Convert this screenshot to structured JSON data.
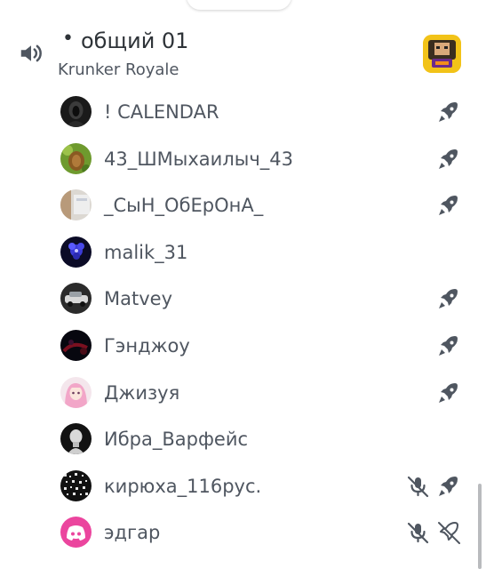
{
  "channel": {
    "name": "общий 01",
    "bullet": "•",
    "activity": "Krunker Royale",
    "speaker_icon": "speaker-icon",
    "activity_icon": "krunker-game-icon"
  },
  "members": [
    {
      "name": "! CALENDAR",
      "avatar_icon": "dark-hooded-figure-avatar",
      "icons": [
        "rocket-icon"
      ]
    },
    {
      "name": "43_ШМыхаилыч_43",
      "avatar_icon": "pinecone-avatar",
      "icons": [
        "rocket-icon"
      ]
    },
    {
      "name": "_СыН_ОбЕрОнА_",
      "avatar_icon": "pale-photo-avatar",
      "icons": [
        "rocket-icon"
      ]
    },
    {
      "name": "malik_31",
      "avatar_icon": "blue-flower-avatar",
      "icons": []
    },
    {
      "name": "Matvey",
      "avatar_icon": "car-avatar",
      "icons": [
        "rocket-icon"
      ]
    },
    {
      "name": "Гэнджоу",
      "avatar_icon": "dark-red-avatar",
      "icons": [
        "rocket-icon"
      ]
    },
    {
      "name": "Джизуя",
      "avatar_icon": "anime-girl-avatar",
      "icons": [
        "rocket-icon"
      ]
    },
    {
      "name": "Ибра_Варфейс",
      "avatar_icon": "statue-bust-avatar",
      "icons": []
    },
    {
      "name": "кирюха_116рус.",
      "avatar_icon": "bw-pattern-avatar",
      "icons": [
        "muted-mic-icon",
        "rocket-icon"
      ]
    },
    {
      "name": "эдгар",
      "avatar_icon": "discord-default-avatar",
      "icons": [
        "muted-mic-icon",
        "no-rocket-icon"
      ]
    }
  ],
  "colors": {
    "text_primary": "#2e3338",
    "text_secondary": "#4f5660",
    "icon_gray": "#4f5660",
    "discord_pink": "#eb459e"
  }
}
